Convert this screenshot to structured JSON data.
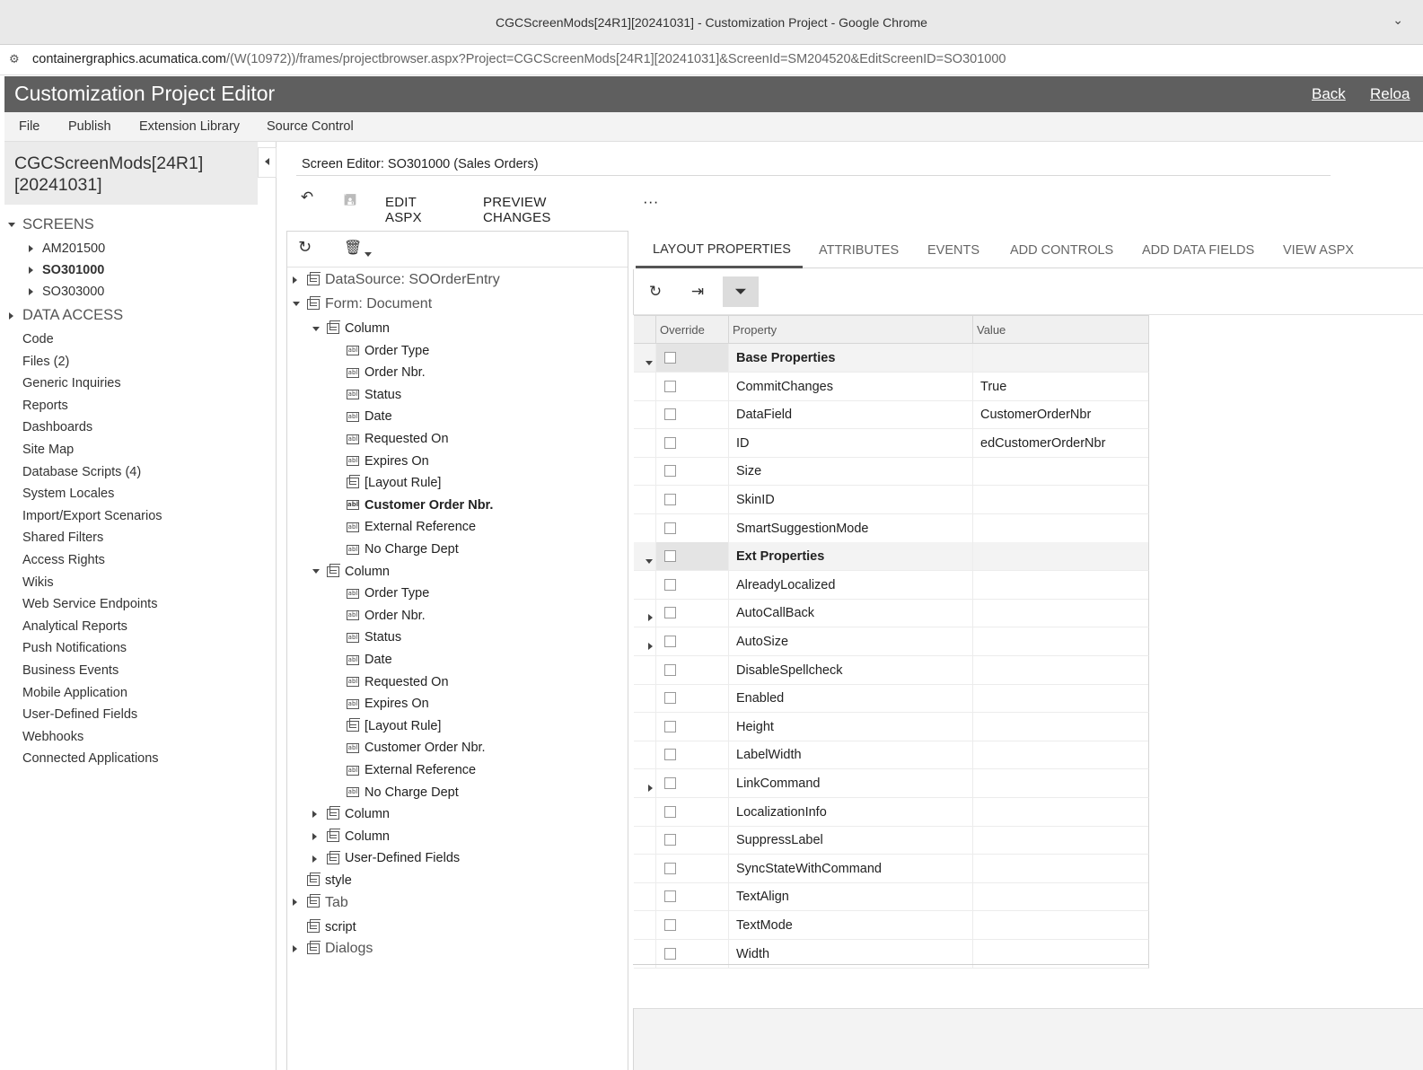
{
  "browser": {
    "window_title": "CGCScreenMods[24R1][20241031] - Customization Project - Google Chrome",
    "url_domain": "containergraphics.acumatica.com",
    "url_path": "/(W(10972))/frames/projectbrowser.aspx?Project=CGCScreenMods[24R1][20241031]&ScreenId=SM204520&EditScreenID=SO301000"
  },
  "header": {
    "title": "Customization Project Editor",
    "back_label": "Back",
    "reload_label": "Reloa"
  },
  "menu": [
    "File",
    "Publish",
    "Extension Library",
    "Source Control"
  ],
  "sidebar": {
    "project_name": "CGCScreenMods[24R1] [20241031]",
    "screens_label": "SCREENS",
    "screens": [
      {
        "label": "AM201500",
        "selected": false
      },
      {
        "label": "SO301000",
        "selected": true
      },
      {
        "label": "SO303000",
        "selected": false
      }
    ],
    "data_access_label": "DATA ACCESS",
    "items": [
      "Code",
      "Files (2)",
      "Generic Inquiries",
      "Reports",
      "Dashboards",
      "Site Map",
      "Database Scripts (4)",
      "System Locales",
      "Import/Export Scenarios",
      "Shared Filters",
      "Access Rights",
      "Wikis",
      "Web Service Endpoints",
      "Analytical Reports",
      "Push Notifications",
      "Business Events",
      "Mobile Application",
      "User-Defined Fields",
      "Webhooks",
      "Connected Applications"
    ]
  },
  "editor": {
    "screen_title": "Screen Editor: SO301000 (Sales Orders)",
    "edit_aspx": "EDIT ASPX",
    "preview_changes": "PREVIEW CHANGES",
    "more": "···"
  },
  "tree": {
    "nodes": [
      {
        "label": "DataSource: SOOrderEntry",
        "level": 0,
        "toggle": "collapsed",
        "icon": "grid",
        "big": true
      },
      {
        "label": "Form: Document",
        "level": 0,
        "toggle": "expanded",
        "icon": "grid",
        "big": true
      },
      {
        "label": "Column",
        "level": 1,
        "toggle": "expanded",
        "icon": "grid"
      },
      {
        "label": "Order Type",
        "level": 2,
        "icon": "abl"
      },
      {
        "label": "Order Nbr.",
        "level": 2,
        "icon": "abl"
      },
      {
        "label": "Status",
        "level": 2,
        "icon": "abl"
      },
      {
        "label": "Date",
        "level": 2,
        "icon": "abl"
      },
      {
        "label": "Requested On",
        "level": 2,
        "icon": "abl"
      },
      {
        "label": "Expires On",
        "level": 2,
        "icon": "abl"
      },
      {
        "label": "[Layout Rule]",
        "level": 2,
        "icon": "grid"
      },
      {
        "label": "Customer Order Nbr.",
        "level": 2,
        "icon": "abl",
        "bold": true
      },
      {
        "label": "External Reference",
        "level": 2,
        "icon": "abl"
      },
      {
        "label": "No Charge Dept",
        "level": 2,
        "icon": "abl"
      },
      {
        "label": "Column",
        "level": 1,
        "toggle": "expanded",
        "icon": "grid"
      },
      {
        "label": "Order Type",
        "level": 2,
        "icon": "abl"
      },
      {
        "label": "Order Nbr.",
        "level": 2,
        "icon": "abl"
      },
      {
        "label": "Status",
        "level": 2,
        "icon": "abl"
      },
      {
        "label": "Date",
        "level": 2,
        "icon": "abl"
      },
      {
        "label": "Requested On",
        "level": 2,
        "icon": "abl"
      },
      {
        "label": "Expires On",
        "level": 2,
        "icon": "abl"
      },
      {
        "label": "[Layout Rule]",
        "level": 2,
        "icon": "grid"
      },
      {
        "label": "Customer Order Nbr.",
        "level": 2,
        "icon": "abl"
      },
      {
        "label": "External Reference",
        "level": 2,
        "icon": "abl"
      },
      {
        "label": "No Charge Dept",
        "level": 2,
        "icon": "abl"
      },
      {
        "label": "Column",
        "level": 1,
        "toggle": "collapsed",
        "icon": "grid"
      },
      {
        "label": "Column",
        "level": 1,
        "toggle": "collapsed",
        "icon": "grid"
      },
      {
        "label": "User-Defined Fields",
        "level": 1,
        "toggle": "collapsed",
        "icon": "grid"
      },
      {
        "label": "style",
        "level": 0,
        "icon": "grid"
      },
      {
        "label": "Tab",
        "level": 0,
        "toggle": "collapsed",
        "icon": "grid",
        "big": true
      },
      {
        "label": "script",
        "level": 0,
        "icon": "grid"
      },
      {
        "label": "Dialogs",
        "level": 0,
        "toggle": "collapsed",
        "icon": "grid",
        "big": true
      }
    ]
  },
  "tabs": [
    {
      "label": "LAYOUT PROPERTIES",
      "active": true
    },
    {
      "label": "ATTRIBUTES",
      "active": false
    },
    {
      "label": "EVENTS",
      "active": false
    },
    {
      "label": "ADD CONTROLS",
      "active": false
    },
    {
      "label": "ADD DATA FIELDS",
      "active": false
    },
    {
      "label": "VIEW ASPX",
      "active": false
    }
  ],
  "grid": {
    "headers": {
      "override": "Override",
      "property": "Property",
      "value": "Value"
    },
    "rows": [
      {
        "property": "Base Properties",
        "value": "",
        "group": true,
        "expand": "down"
      },
      {
        "property": "CommitChanges",
        "value": "True"
      },
      {
        "property": "DataField",
        "value": "CustomerOrderNbr"
      },
      {
        "property": "ID",
        "value": "edCustomerOrderNbr"
      },
      {
        "property": "Size",
        "value": ""
      },
      {
        "property": "SkinID",
        "value": ""
      },
      {
        "property": "SmartSuggestionMode",
        "value": ""
      },
      {
        "property": "Ext Properties",
        "value": "",
        "group": true,
        "expand": "down"
      },
      {
        "property": "AlreadyLocalized",
        "value": ""
      },
      {
        "property": "AutoCallBack",
        "value": "",
        "expand": "right"
      },
      {
        "property": "AutoSize",
        "value": "",
        "expand": "right"
      },
      {
        "property": "DisableSpellcheck",
        "value": ""
      },
      {
        "property": "Enabled",
        "value": ""
      },
      {
        "property": "Height",
        "value": ""
      },
      {
        "property": "LabelWidth",
        "value": ""
      },
      {
        "property": "LinkCommand",
        "value": "",
        "expand": "right"
      },
      {
        "property": "LocalizationInfo",
        "value": ""
      },
      {
        "property": "SuppressLabel",
        "value": ""
      },
      {
        "property": "SyncStateWithCommand",
        "value": ""
      },
      {
        "property": "TextAlign",
        "value": ""
      },
      {
        "property": "TextMode",
        "value": ""
      },
      {
        "property": "Width",
        "value": ""
      }
    ]
  }
}
